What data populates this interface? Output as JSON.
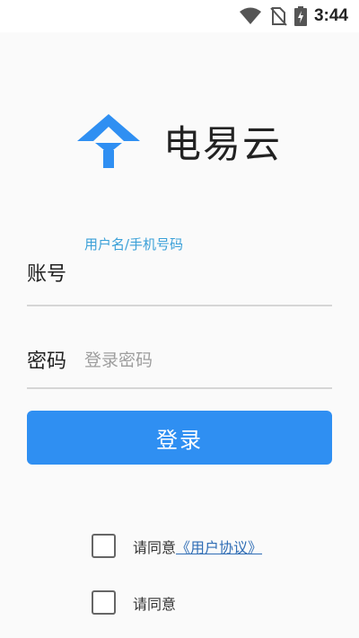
{
  "status_bar": {
    "time": "3:44",
    "icons": [
      "wifi-icon",
      "no-sim-icon",
      "battery-charging-icon"
    ]
  },
  "app": {
    "name": "电易云",
    "logo_icon": "app-logo-icon",
    "brand_color": "#2f8ff2"
  },
  "form": {
    "account": {
      "label": "账号",
      "floating_hint": "用户名/手机号码",
      "value": ""
    },
    "password": {
      "label": "密码",
      "placeholder": "登录密码",
      "value": ""
    },
    "login_label": "登录"
  },
  "agreements": [
    {
      "prefix": "请同意",
      "link": "《用户协议》",
      "checked": false
    },
    {
      "prefix": "请同意",
      "link": "",
      "checked": false
    }
  ]
}
